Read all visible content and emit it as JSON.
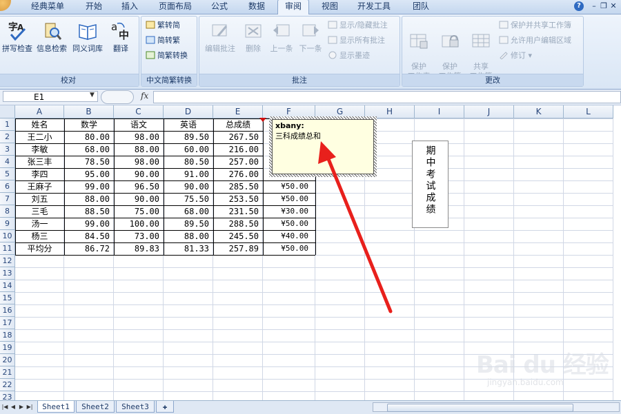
{
  "ribbon_tabs": [
    "经典菜单",
    "开始",
    "插入",
    "页面布局",
    "公式",
    "数据",
    "审阅",
    "视图",
    "开发工具",
    "团队"
  ],
  "active_tab": "审阅",
  "groups": {
    "proofing": {
      "label": "校对",
      "buttons": [
        "拼写检查",
        "信息检索",
        "同义词库",
        "翻译"
      ]
    },
    "chinese_conversion": {
      "label": "中文简繁转换",
      "buttons": [
        "繁转简",
        "简转繁",
        "简繁转换"
      ]
    },
    "comments": {
      "label": "批注",
      "buttons": [
        "编辑批注",
        "删除",
        "上一条",
        "下一条"
      ],
      "options": [
        "显示/隐藏批注",
        "显示所有批注",
        "显示墨迹"
      ]
    },
    "changes": {
      "label": "更改",
      "buttons": [
        "保护\n工作表",
        "保护\n工作簿",
        "共享\n工作簿"
      ],
      "options": [
        "保护并共享工作簿",
        "允许用户编辑区域",
        "修订"
      ]
    }
  },
  "formula_bar": {
    "name_box": "E1",
    "fx": "fx",
    "formula": ""
  },
  "columns": [
    "A",
    "B",
    "C",
    "D",
    "E",
    "F",
    "G",
    "H",
    "I",
    "J",
    "K",
    "L"
  ],
  "rows": [
    "1",
    "2",
    "3",
    "4",
    "5",
    "6",
    "7",
    "8",
    "9",
    "10",
    "11",
    "12",
    "13",
    "14",
    "15",
    "16",
    "17",
    "18",
    "19",
    "20",
    "21",
    "22",
    "23"
  ],
  "table": {
    "header": [
      "姓名",
      "数学",
      "语文",
      "英语",
      "总成绩"
    ],
    "body": [
      [
        "王二小",
        "80.00",
        "98.00",
        "89.50",
        "267.50",
        ""
      ],
      [
        "李敏",
        "68.00",
        "88.00",
        "60.00",
        "216.00",
        ""
      ],
      [
        "张三丰",
        "78.50",
        "98.00",
        "80.50",
        "257.00",
        ""
      ],
      [
        "李四",
        "95.00",
        "90.00",
        "91.00",
        "276.00",
        ""
      ],
      [
        "王麻子",
        "99.00",
        "96.50",
        "90.00",
        "285.50",
        "¥50.00"
      ],
      [
        "刘五",
        "88.00",
        "90.00",
        "75.50",
        "253.50",
        "¥50.00"
      ],
      [
        "三毛",
        "88.50",
        "75.00",
        "68.00",
        "231.50",
        "¥30.00"
      ],
      [
        "汤一",
        "99.00",
        "100.00",
        "89.50",
        "288.50",
        "¥50.00"
      ],
      [
        "杨三",
        "84.50",
        "73.00",
        "88.00",
        "245.50",
        "¥40.00"
      ],
      [
        "平均分",
        "86.72",
        "89.83",
        "81.33",
        "257.89",
        "¥50.00"
      ]
    ]
  },
  "comment": {
    "author": "xbany:",
    "text": "三科成绩总和"
  },
  "textbox": {
    "text": "期中考试成绩"
  },
  "sheet_tabs": [
    "Sheet1",
    "Sheet2",
    "Sheet3"
  ],
  "active_sheet": "Sheet1",
  "watermark": {
    "brand": "Bai du 经验",
    "url": "jingyan.baidu.com"
  },
  "colors": {
    "arrow": "#e8201c",
    "comment_bg": "#ffffe1",
    "ribbon_text": "#1d3a67"
  }
}
